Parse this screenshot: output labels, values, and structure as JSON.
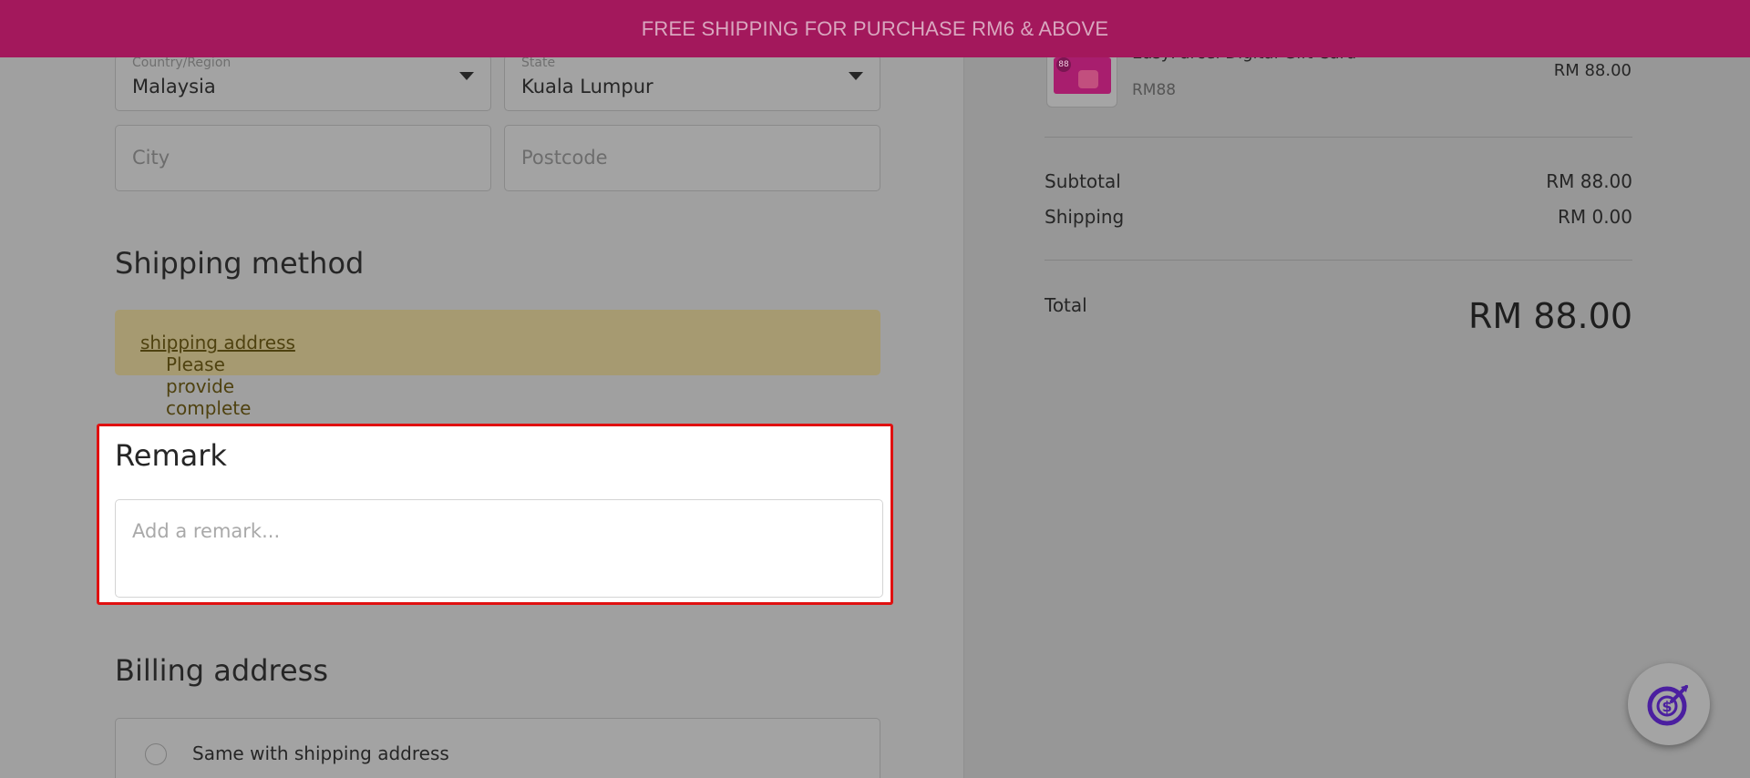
{
  "banner": {
    "text": "FREE SHIPPING FOR PURCHASE RM6 & ABOVE"
  },
  "address": {
    "country": {
      "label": "Country/Region",
      "value": "Malaysia"
    },
    "state": {
      "label": "State",
      "value": "Kuala Lumpur"
    },
    "city": {
      "placeholder": "City"
    },
    "postcode": {
      "placeholder": "Postcode"
    }
  },
  "shipping_method": {
    "title": "Shipping method",
    "notice_prefix": "Please provide complete ",
    "notice_link": "shipping address"
  },
  "remark": {
    "title": "Remark",
    "placeholder": "Add a remark..."
  },
  "billing": {
    "title": "Billing address",
    "option_same": "Same with shipping address"
  },
  "order_summary": {
    "product": {
      "name": "EasyParcel Digital Gift Card",
      "variant": "RM88",
      "price": "RM 88.00",
      "thumb_badge": "88"
    },
    "subtotal_label": "Subtotal",
    "subtotal_value": "RM 88.00",
    "shipping_label": "Shipping",
    "shipping_value": "RM 0.00",
    "total_label": "Total",
    "total_value": "RM 88.00"
  },
  "colors": {
    "banner": "#a3185c",
    "highlight": "#e01010",
    "fab_icon": "#4b1fa0"
  },
  "icons": {
    "fab": "target-dollar-icon",
    "select_caret": "caret-down-icon",
    "radio": "radio-empty-icon"
  }
}
